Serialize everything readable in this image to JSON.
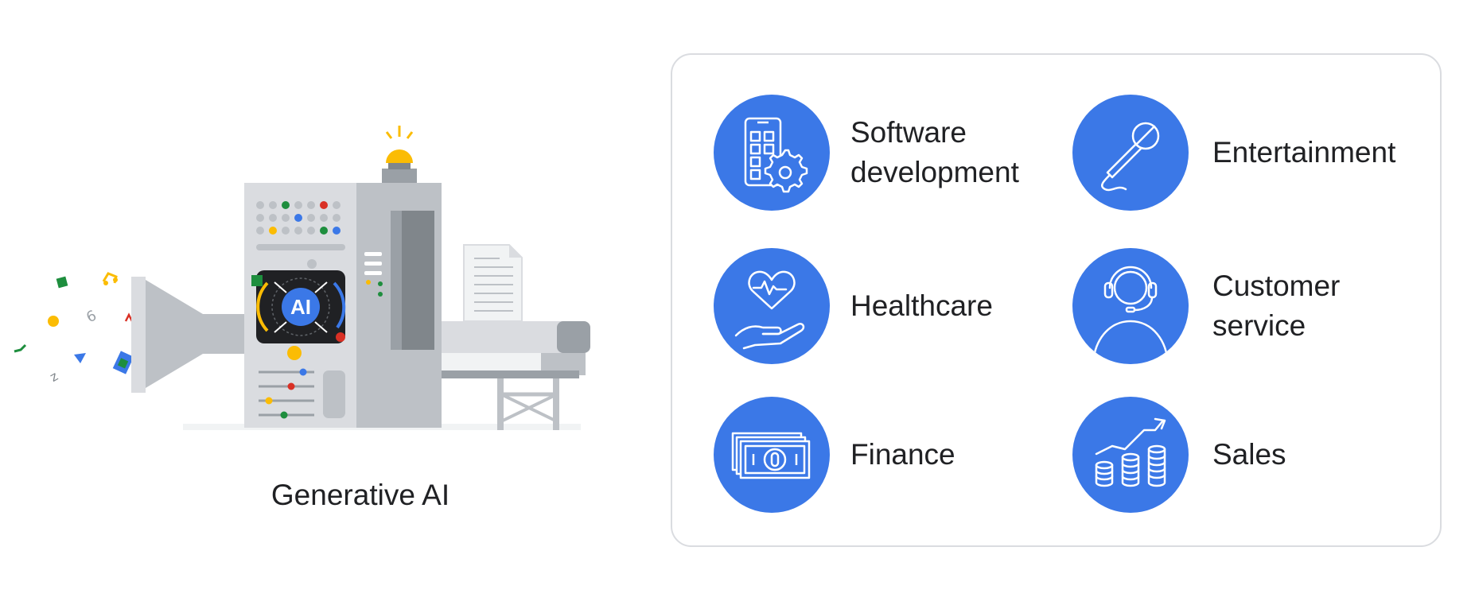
{
  "illustration": {
    "caption": "Generative AI",
    "screen_text": "AI",
    "icon": "ai-machine-illustration"
  },
  "colors": {
    "accent_blue": "#3b78e7",
    "google_red": "#d93025",
    "google_green": "#1e8e3e",
    "google_yellow": "#fbbc04",
    "machine_gray": "#dadce0",
    "panel_border": "#dadce0"
  },
  "use_cases": [
    {
      "label": "Software\ndevelopment",
      "icon": "phone-gear-icon"
    },
    {
      "label": "Entertainment",
      "icon": "microphone-icon"
    },
    {
      "label": "Healthcare",
      "icon": "heart-hand-icon"
    },
    {
      "label": "Customer\nservice",
      "icon": "headset-person-icon"
    },
    {
      "label": "Finance",
      "icon": "banknotes-icon"
    },
    {
      "label": "Sales",
      "icon": "coins-chart-icon"
    }
  ]
}
